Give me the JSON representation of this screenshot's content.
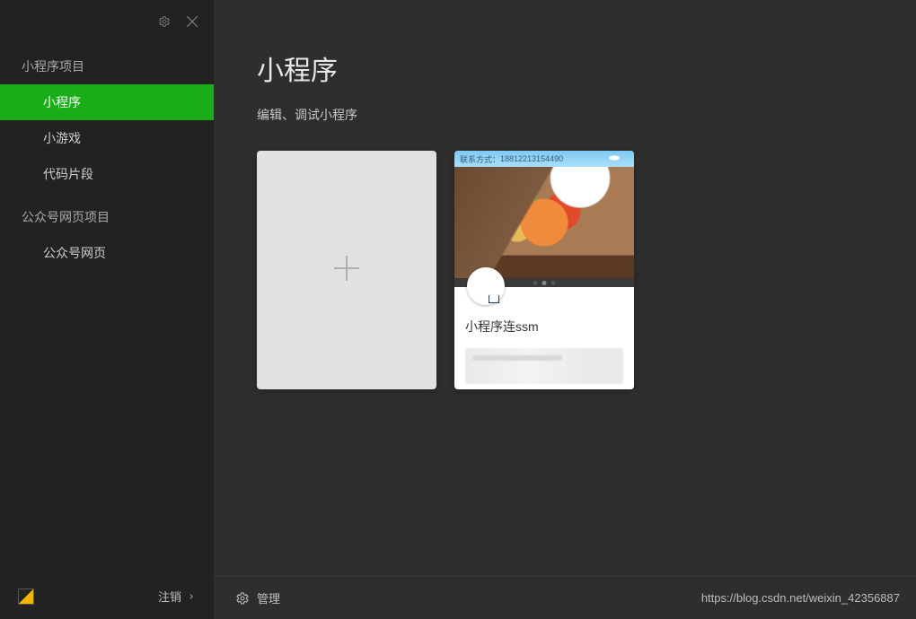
{
  "sidebar": {
    "groups": [
      {
        "title": "小程序项目",
        "items": [
          {
            "label": "小程序",
            "active": true
          },
          {
            "label": "小游戏",
            "active": false
          },
          {
            "label": "代码片段",
            "active": false
          }
        ]
      },
      {
        "title": "公众号网页项目",
        "items": [
          {
            "label": "公众号网页",
            "active": false
          }
        ]
      }
    ],
    "logout": "注销"
  },
  "main": {
    "title": "小程序",
    "subtitle": "编辑、调试小程序",
    "preview_banner_label": "联系方式：",
    "preview_banner_value": "18812213154490",
    "project_name": "小程序连ssm",
    "manage_label": "管理"
  },
  "watermark": "https://blog.csdn.net/weixin_42356887"
}
